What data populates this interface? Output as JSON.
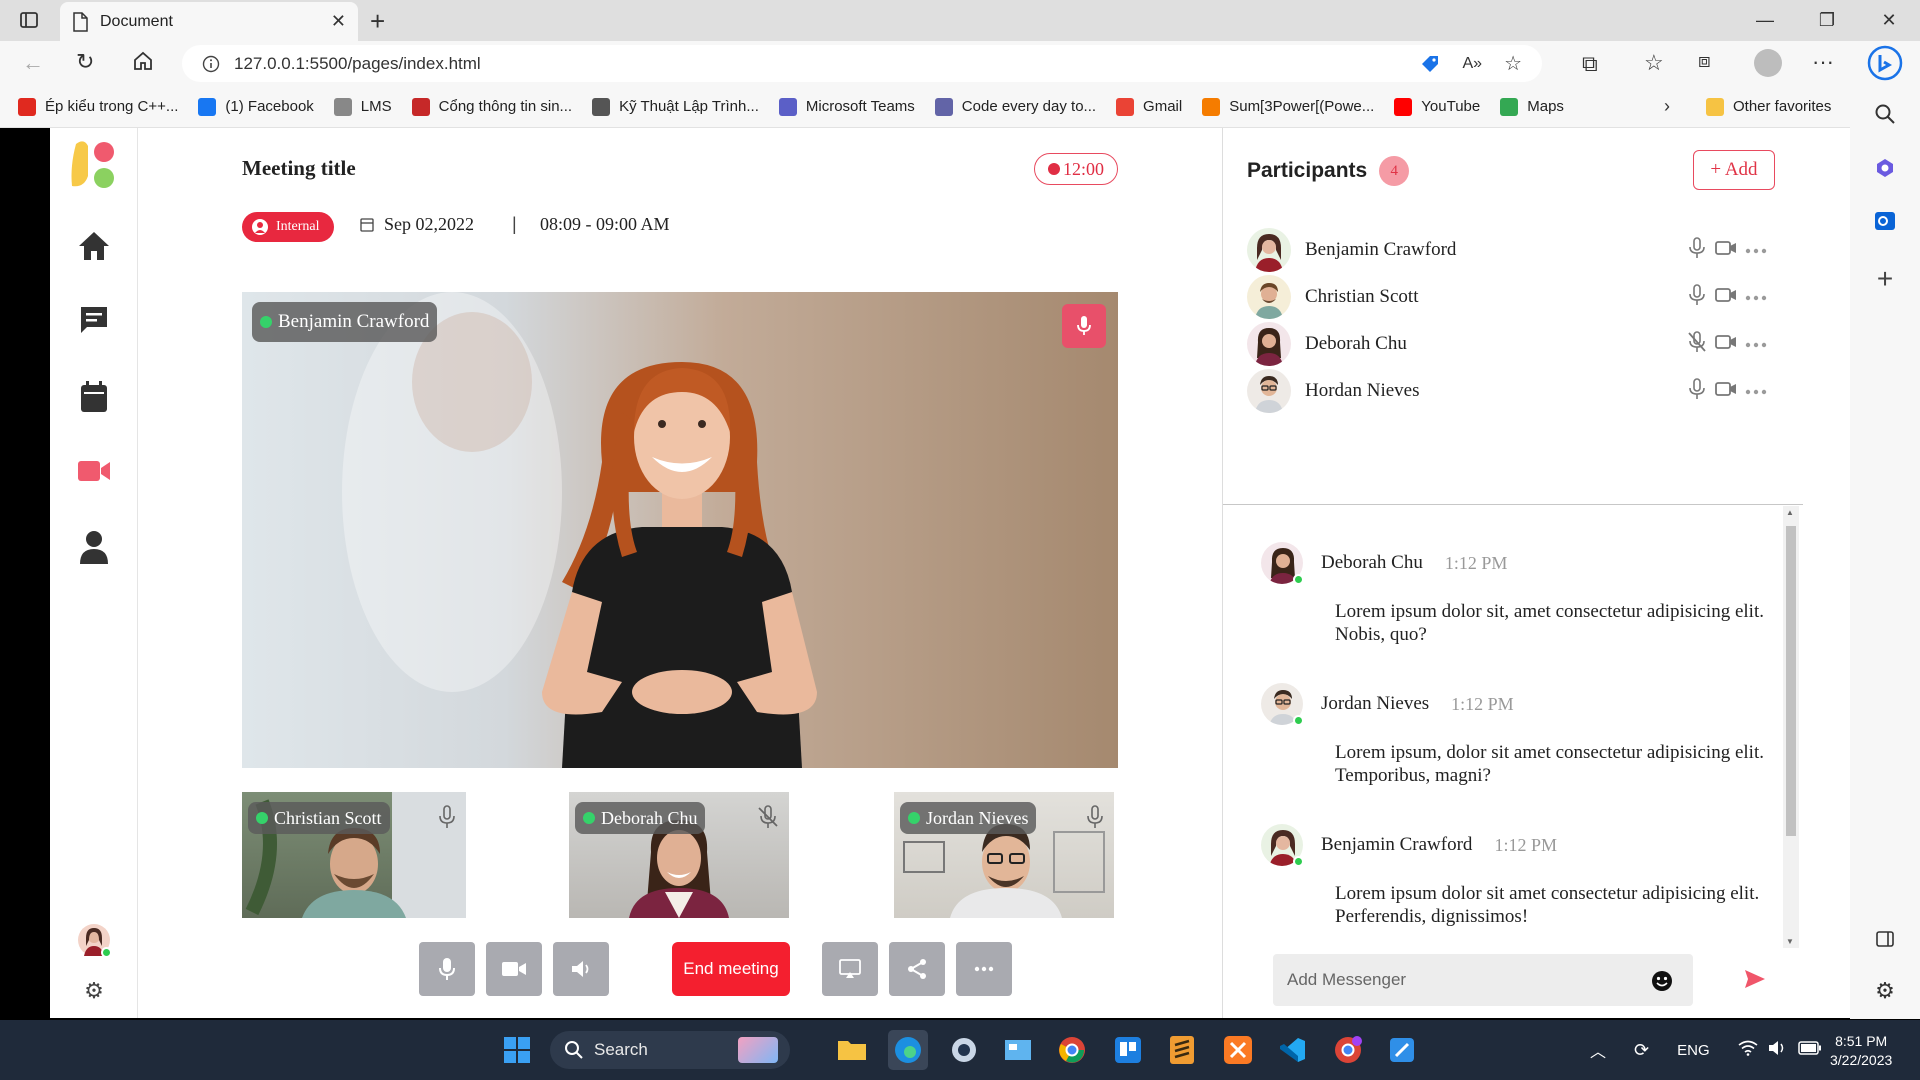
{
  "browser": {
    "tab_title": "Document",
    "url": "127.0.0.1:5500/pages/index.html",
    "bookmarks": [
      {
        "label": "Ép kiểu trong C++...",
        "icon": "t-icon",
        "color": "#e0291f"
      },
      {
        "label": "(1) Facebook",
        "icon": "facebook-icon",
        "color": "#1877f2"
      },
      {
        "label": "LMS",
        "icon": "lms-icon",
        "color": "#888888"
      },
      {
        "label": "Cổng thông tin sin...",
        "icon": "university-icon",
        "color": "#c62828"
      },
      {
        "label": "Kỹ Thuật Lập Trình...",
        "icon": "document-icon",
        "color": "#555555"
      },
      {
        "label": "Microsoft Teams",
        "icon": "teams-icon",
        "color": "#5b5fc7"
      },
      {
        "label": "Code every day to...",
        "icon": "code-icon",
        "color": "#6264a7"
      },
      {
        "label": "Gmail",
        "icon": "gmail-icon",
        "color": "#ea4335"
      },
      {
        "label": "Sum[3Power[(Powe...",
        "icon": "wolfram-icon",
        "color": "#f57c00"
      },
      {
        "label": "YouTube",
        "icon": "youtube-icon",
        "color": "#ff0000"
      },
      {
        "label": "Maps",
        "icon": "maps-icon",
        "color": "#34a853"
      }
    ],
    "other_favorites": "Other favorites"
  },
  "meeting": {
    "title": "Meeting title",
    "timer": "12:00",
    "type_badge": "Internal",
    "date": "Sep 02,2022",
    "separator": "|",
    "time_range": "08:09 - 09:00 AM",
    "main_speaker": "Benjamin Crawford",
    "thumbnails": [
      {
        "name": "Christian Scott",
        "muted": false
      },
      {
        "name": "Deborah Chu",
        "muted": true
      },
      {
        "name": "Jordan Nieves",
        "muted": false
      }
    ],
    "end_label": "End meeting"
  },
  "participants": {
    "title": "Participants",
    "count": "4",
    "add_label": "+ Add",
    "list": [
      {
        "name": "Benjamin Crawford",
        "muted": false
      },
      {
        "name": "Christian Scott",
        "muted": false
      },
      {
        "name": "Deborah Chu",
        "muted": true
      },
      {
        "name": "Hordan Nieves",
        "muted": false
      }
    ]
  },
  "chat": {
    "messages": [
      {
        "name": "Deborah Chu",
        "time": "1:12 PM",
        "text": "Lorem ipsum dolor sit, amet consectetur adipisicing elit. Nobis, quo?"
      },
      {
        "name": "Jordan Nieves",
        "time": "1:12 PM",
        "text": "Lorem ipsum, dolor sit amet consectetur adipisicing elit. Temporibus, magni?"
      },
      {
        "name": "Benjamin Crawford",
        "time": "1:12 PM",
        "text": "Lorem ipsum dolor sit amet consectetur adipisicing elit. Perferendis, dignissimos!"
      }
    ],
    "input_placeholder": "Add Messenger"
  },
  "taskbar": {
    "search_label": "Search",
    "language": "ENG",
    "time": "8:51 PM",
    "date": "3/22/2023"
  },
  "colors": {
    "accent": "#e8283f",
    "online": "#35d26a",
    "control_gray": "#a9aab0",
    "end_red": "#f41f2f"
  }
}
